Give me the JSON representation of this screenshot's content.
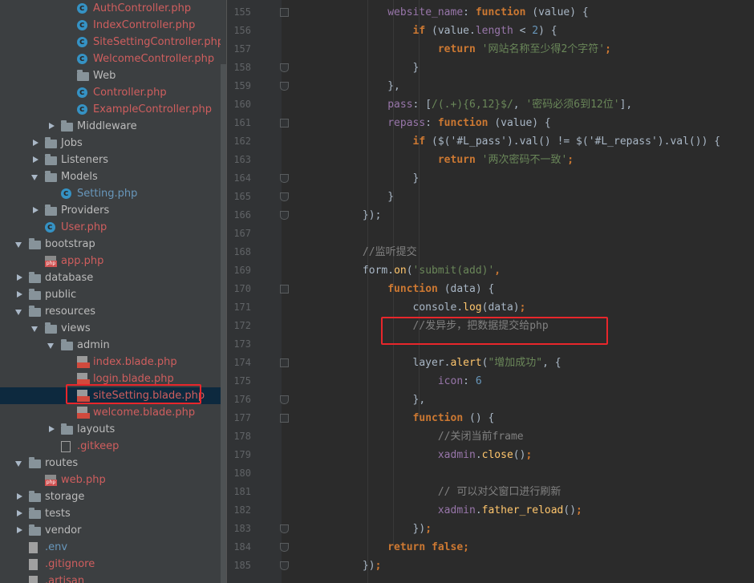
{
  "project_tree": {
    "items": [
      {
        "label": "AuthController.php",
        "kind": "class",
        "color": "red",
        "indent": 3
      },
      {
        "label": "IndexController.php",
        "kind": "class",
        "color": "red",
        "indent": 3
      },
      {
        "label": "SiteSettingController.php",
        "kind": "class",
        "color": "red",
        "indent": 3
      },
      {
        "label": "WelcomeController.php",
        "kind": "class",
        "color": "red",
        "indent": 3
      },
      {
        "label": "Web",
        "kind": "folder",
        "color": "grey",
        "indent": 3
      },
      {
        "label": "Controller.php",
        "kind": "class",
        "color": "red",
        "indent": 3
      },
      {
        "label": "ExampleController.php",
        "kind": "class",
        "color": "red",
        "indent": 3
      },
      {
        "label": "Middleware",
        "kind": "folder",
        "color": "grey",
        "indent": 2,
        "arrow": "right"
      },
      {
        "label": "Jobs",
        "kind": "folder",
        "color": "grey",
        "indent": 1,
        "arrow": "right"
      },
      {
        "label": "Listeners",
        "kind": "folder",
        "color": "grey",
        "indent": 1,
        "arrow": "right"
      },
      {
        "label": "Models",
        "kind": "folder",
        "color": "grey",
        "indent": 1,
        "arrow": "down"
      },
      {
        "label": "Setting.php",
        "kind": "class",
        "color": "blue",
        "indent": 2
      },
      {
        "label": "Providers",
        "kind": "folder",
        "color": "grey",
        "indent": 1,
        "arrow": "right"
      },
      {
        "label": "User.php",
        "kind": "class",
        "color": "red",
        "indent": 1
      },
      {
        "label": "bootstrap",
        "kind": "folder",
        "color": "grey",
        "indent": 0,
        "arrow": "down"
      },
      {
        "label": "app.php",
        "kind": "php",
        "color": "red",
        "indent": 1
      },
      {
        "label": "database",
        "kind": "folder",
        "color": "grey",
        "indent": 0,
        "arrow": "right"
      },
      {
        "label": "public",
        "kind": "folder",
        "color": "grey",
        "indent": 0,
        "arrow": "right"
      },
      {
        "label": "resources",
        "kind": "folder",
        "color": "grey",
        "indent": 0,
        "arrow": "down"
      },
      {
        "label": "views",
        "kind": "folder",
        "color": "grey",
        "indent": 1,
        "arrow": "down"
      },
      {
        "label": "admin",
        "kind": "folder",
        "color": "grey",
        "indent": 2,
        "arrow": "down"
      },
      {
        "label": "index.blade.php",
        "kind": "blade",
        "color": "red",
        "indent": 3
      },
      {
        "label": "login.blade.php",
        "kind": "blade",
        "color": "red",
        "indent": 3
      },
      {
        "label": "siteSetting.blade.php",
        "kind": "blade",
        "color": "red",
        "indent": 3,
        "selected": true
      },
      {
        "label": "welcome.blade.php",
        "kind": "blade",
        "color": "red",
        "indent": 3
      },
      {
        "label": "layouts",
        "kind": "folder",
        "color": "grey",
        "indent": 2,
        "arrow": "right"
      },
      {
        "label": ".gitkeep",
        "kind": "git",
        "color": "red",
        "indent": 2
      },
      {
        "label": "routes",
        "kind": "folder",
        "color": "grey",
        "indent": 0,
        "arrow": "down"
      },
      {
        "label": "web.php",
        "kind": "php",
        "color": "red",
        "indent": 1
      },
      {
        "label": "storage",
        "kind": "folder",
        "color": "grey",
        "indent": 0,
        "arrow": "right"
      },
      {
        "label": "tests",
        "kind": "folder",
        "color": "grey",
        "indent": 0,
        "arrow": "right"
      },
      {
        "label": "vendor",
        "kind": "folder",
        "color": "grey",
        "indent": 0,
        "arrow": "right"
      },
      {
        "label": ".env",
        "kind": "file",
        "color": "blue",
        "indent": 0
      },
      {
        "label": ".gitignore",
        "kind": "file",
        "color": "red",
        "indent": 0
      },
      {
        "label": ".artisan",
        "kind": "file",
        "color": "red",
        "indent": 0
      }
    ]
  },
  "editor": {
    "line_numbers": [
      "155",
      "156",
      "157",
      "158",
      "159",
      "160",
      "161",
      "162",
      "163",
      "164",
      "165",
      "166",
      "167",
      "168",
      "169",
      "170",
      "171",
      "172",
      "173",
      "174",
      "175",
      "176",
      "177",
      "178",
      "179",
      "180",
      "181",
      "182",
      "183",
      "184",
      "185"
    ],
    "lines": [
      [
        {
          "t": "                ",
          "c": "plain"
        },
        {
          "t": "website_name",
          "c": "prop"
        },
        {
          "t": ": ",
          "c": "plain"
        },
        {
          "t": "function ",
          "c": "kw"
        },
        {
          "t": "(value) {",
          "c": "plain"
        }
      ],
      [
        {
          "t": "                    ",
          "c": "plain"
        },
        {
          "t": "if ",
          "c": "kw"
        },
        {
          "t": "(value.",
          "c": "plain"
        },
        {
          "t": "length",
          "c": "prop"
        },
        {
          "t": " < ",
          "c": "plain"
        },
        {
          "t": "2",
          "c": "num"
        },
        {
          "t": ") {",
          "c": "plain"
        }
      ],
      [
        {
          "t": "                        ",
          "c": "plain"
        },
        {
          "t": "return ",
          "c": "kw"
        },
        {
          "t": "'网站名称至少得2个字符'",
          "c": "str"
        },
        {
          "t": ";",
          "c": "kw"
        }
      ],
      [
        {
          "t": "                    }",
          "c": "plain"
        }
      ],
      [
        {
          "t": "                },",
          "c": "plain"
        }
      ],
      [
        {
          "t": "                ",
          "c": "plain"
        },
        {
          "t": "pass",
          "c": "prop"
        },
        {
          "t": ": [",
          "c": "plain"
        },
        {
          "t": "/(.+){6,12}$/",
          "c": "str"
        },
        {
          "t": ", ",
          "c": "plain"
        },
        {
          "t": "'密码必须6到12位'",
          "c": "str"
        },
        {
          "t": "],",
          "c": "plain"
        }
      ],
      [
        {
          "t": "                ",
          "c": "plain"
        },
        {
          "t": "repass",
          "c": "prop"
        },
        {
          "t": ": ",
          "c": "plain"
        },
        {
          "t": "function ",
          "c": "kw"
        },
        {
          "t": "(value) {",
          "c": "plain"
        }
      ],
      [
        {
          "t": "                    ",
          "c": "plain"
        },
        {
          "t": "if ",
          "c": "kw"
        },
        {
          "t": "($('#L_pass').val() != $('#L_repass').val()) {",
          "c": "plain"
        }
      ],
      [
        {
          "t": "                        ",
          "c": "plain"
        },
        {
          "t": "return ",
          "c": "kw"
        },
        {
          "t": "'两次密码不一致'",
          "c": "str"
        },
        {
          "t": ";",
          "c": "kw"
        }
      ],
      [
        {
          "t": "                    }",
          "c": "plain"
        }
      ],
      [
        {
          "t": "                }",
          "c": "plain"
        }
      ],
      [
        {
          "t": "            });",
          "c": "plain"
        }
      ],
      [
        {
          "t": "",
          "c": "plain"
        }
      ],
      [
        {
          "t": "            ",
          "c": "plain"
        },
        {
          "t": "//监听提交",
          "c": "cm"
        }
      ],
      [
        {
          "t": "            form.",
          "c": "plain"
        },
        {
          "t": "on",
          "c": "fn"
        },
        {
          "t": "(",
          "c": "plain"
        },
        {
          "t": "'submit(add)'",
          "c": "str"
        },
        {
          "t": ",",
          "c": "kw"
        }
      ],
      [
        {
          "t": "                ",
          "c": "plain"
        },
        {
          "t": "function ",
          "c": "kw"
        },
        {
          "t": "(data) {",
          "c": "plain"
        }
      ],
      [
        {
          "t": "                    console.",
          "c": "plain"
        },
        {
          "t": "log",
          "c": "fn"
        },
        {
          "t": "(data)",
          "c": "plain"
        },
        {
          "t": ";",
          "c": "kw"
        }
      ],
      [
        {
          "t": "                    ",
          "c": "plain"
        },
        {
          "t": "//发异步，把数据提交给php",
          "c": "cm"
        }
      ],
      [
        {
          "t": "",
          "c": "plain"
        }
      ],
      [
        {
          "t": "                    layer.",
          "c": "plain"
        },
        {
          "t": "alert",
          "c": "fn"
        },
        {
          "t": "(",
          "c": "plain"
        },
        {
          "t": "\"增加成功\"",
          "c": "str"
        },
        {
          "t": ", {",
          "c": "plain"
        }
      ],
      [
        {
          "t": "                        ",
          "c": "plain"
        },
        {
          "t": "icon",
          "c": "prop"
        },
        {
          "t": ": ",
          "c": "plain"
        },
        {
          "t": "6",
          "c": "num"
        }
      ],
      [
        {
          "t": "                    },",
          "c": "plain"
        }
      ],
      [
        {
          "t": "                    ",
          "c": "plain"
        },
        {
          "t": "function ",
          "c": "kw"
        },
        {
          "t": "() {",
          "c": "plain"
        }
      ],
      [
        {
          "t": "                        ",
          "c": "plain"
        },
        {
          "t": "//关闭当前frame",
          "c": "cm"
        }
      ],
      [
        {
          "t": "                        ",
          "c": "plain"
        },
        {
          "t": "xadmin",
          "c": "prop"
        },
        {
          "t": ".",
          "c": "plain"
        },
        {
          "t": "close",
          "c": "fn"
        },
        {
          "t": "()",
          "c": "plain"
        },
        {
          "t": ";",
          "c": "kw"
        }
      ],
      [
        {
          "t": "",
          "c": "plain"
        }
      ],
      [
        {
          "t": "                        ",
          "c": "plain"
        },
        {
          "t": "// 可以对父窗口进行刷新",
          "c": "cm"
        }
      ],
      [
        {
          "t": "                        ",
          "c": "plain"
        },
        {
          "t": "xadmin",
          "c": "prop"
        },
        {
          "t": ".",
          "c": "plain"
        },
        {
          "t": "father_reload",
          "c": "fn"
        },
        {
          "t": "()",
          "c": "plain"
        },
        {
          "t": ";",
          "c": "kw"
        }
      ],
      [
        {
          "t": "                    })",
          "c": "plain"
        },
        {
          "t": ";",
          "c": "kw"
        }
      ],
      [
        {
          "t": "                ",
          "c": "plain"
        },
        {
          "t": "return false",
          "c": "kw"
        },
        {
          "t": ";",
          "c": "kw"
        }
      ],
      [
        {
          "t": "            })",
          "c": "plain"
        },
        {
          "t": ";",
          "c": "kw"
        }
      ]
    ]
  },
  "colors": {
    "annotation_box": "#e8262b",
    "keyword": "#cc7832",
    "string": "#6a8759",
    "comment": "#808080"
  }
}
